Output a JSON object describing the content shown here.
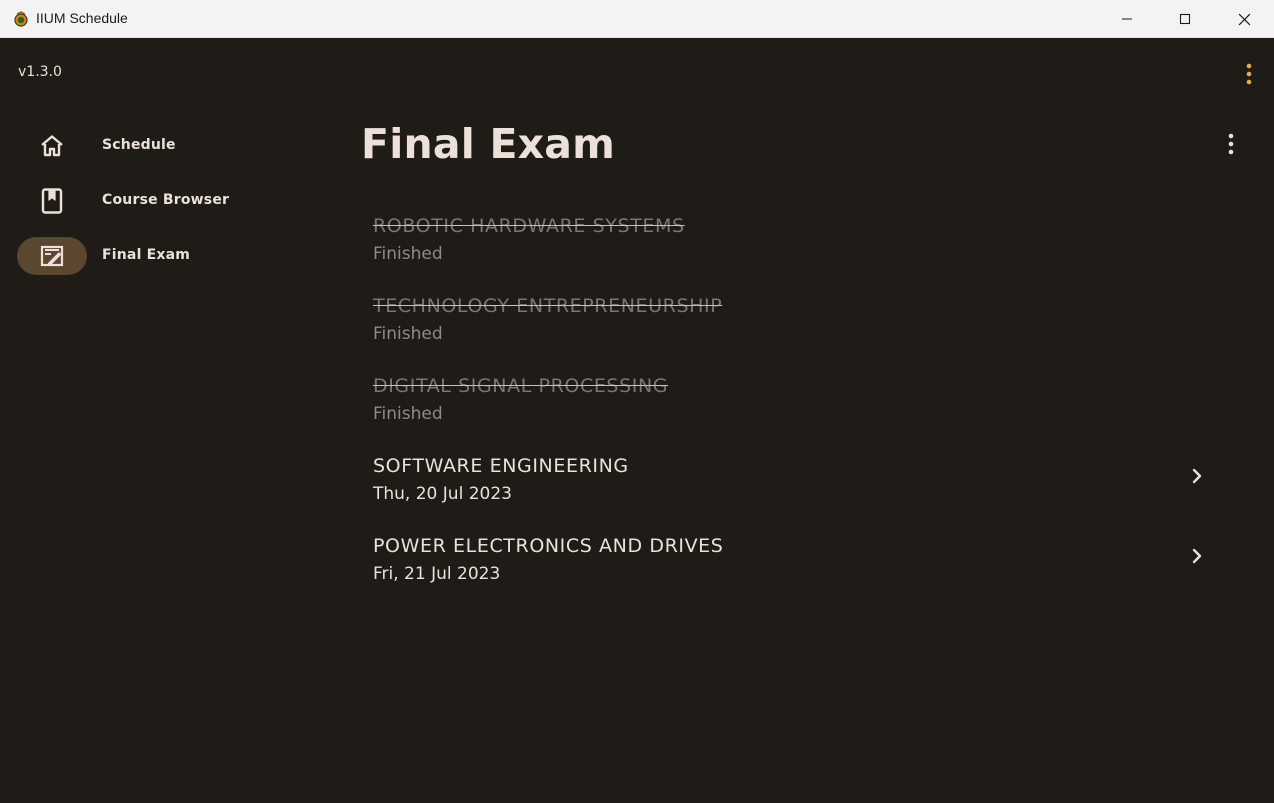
{
  "window": {
    "title": "IIUM Schedule",
    "minimize_icon": "minimize-icon",
    "maximize_icon": "maximize-icon",
    "close_icon": "close-icon"
  },
  "app": {
    "version": "v1.3.0"
  },
  "nav": {
    "items": [
      {
        "label": "Schedule",
        "icon": "home-icon",
        "active": false
      },
      {
        "label": "Course Browser",
        "icon": "book-icon",
        "active": false
      },
      {
        "label": "Final Exam",
        "icon": "exam-icon",
        "active": true
      }
    ]
  },
  "page": {
    "title": "Final Exam"
  },
  "exams": [
    {
      "name": "ROBOTIC HARDWARE SYSTEMS",
      "detail": "Finished",
      "finished": true
    },
    {
      "name": "TECHNOLOGY ENTREPRENEURSHIP",
      "detail": "Finished",
      "finished": true
    },
    {
      "name": "DIGITAL SIGNAL PROCESSING",
      "detail": "Finished",
      "finished": true
    },
    {
      "name": "SOFTWARE ENGINEERING",
      "detail": "Thu, 20 Jul 2023",
      "finished": false
    },
    {
      "name": "POWER ELECTRONICS AND DRIVES",
      "detail": "Fri, 21 Jul 2023",
      "finished": false
    }
  ],
  "colors": {
    "background": "#1f1b17",
    "text": "#ece0d8",
    "accent": "#f0a94a",
    "active_pill": "#5b4730",
    "finished_text": "#7c7672"
  }
}
